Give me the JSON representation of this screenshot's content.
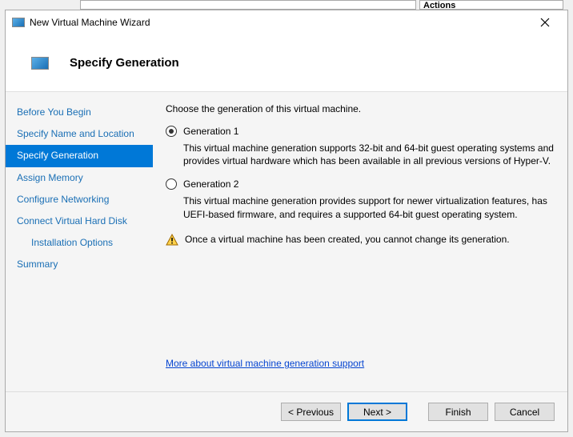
{
  "bg_actions": "Actions",
  "window": {
    "title": "New Virtual Machine Wizard",
    "heading": "Specify Generation"
  },
  "sidebar": {
    "items": [
      {
        "label": "Before You Begin"
      },
      {
        "label": "Specify Name and Location"
      },
      {
        "label": "Specify Generation"
      },
      {
        "label": "Assign Memory"
      },
      {
        "label": "Configure Networking"
      },
      {
        "label": "Connect Virtual Hard Disk"
      },
      {
        "label": "Installation Options"
      },
      {
        "label": "Summary"
      }
    ]
  },
  "content": {
    "intro": "Choose the generation of this virtual machine.",
    "gen1": {
      "label": "Generation 1",
      "desc": "This virtual machine generation supports 32-bit and 64-bit guest operating systems and provides virtual hardware which has been available in all previous versions of Hyper-V."
    },
    "gen2": {
      "label": "Generation 2",
      "desc": "This virtual machine generation provides support for newer virtualization features, has UEFI-based firmware, and requires a supported 64-bit guest operating system."
    },
    "warning": "Once a virtual machine has been created, you cannot change its generation.",
    "link": "More about virtual machine generation support"
  },
  "footer": {
    "previous": "< Previous",
    "next": "Next >",
    "finish": "Finish",
    "cancel": "Cancel"
  }
}
